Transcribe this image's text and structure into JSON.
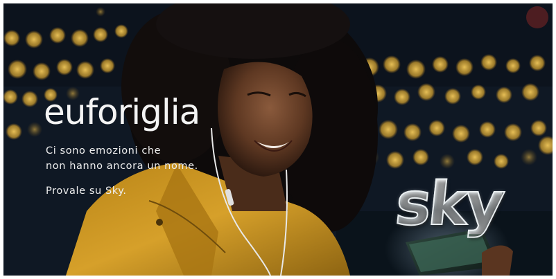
{
  "ad": {
    "headline": "euforiglia",
    "body_line_1": "Ci sono emozioni che",
    "body_line_2": "non hanno ancora un nome.",
    "call_to_action": "Provale su Sky.",
    "brand_logo": "sky"
  },
  "colors": {
    "background_night": "#0c1420",
    "bokeh_gold": "#d9a630",
    "jacket_yellow": "#c9951f",
    "text_white": "#f4f4f4",
    "logo_silver": "#c4ccd0"
  }
}
